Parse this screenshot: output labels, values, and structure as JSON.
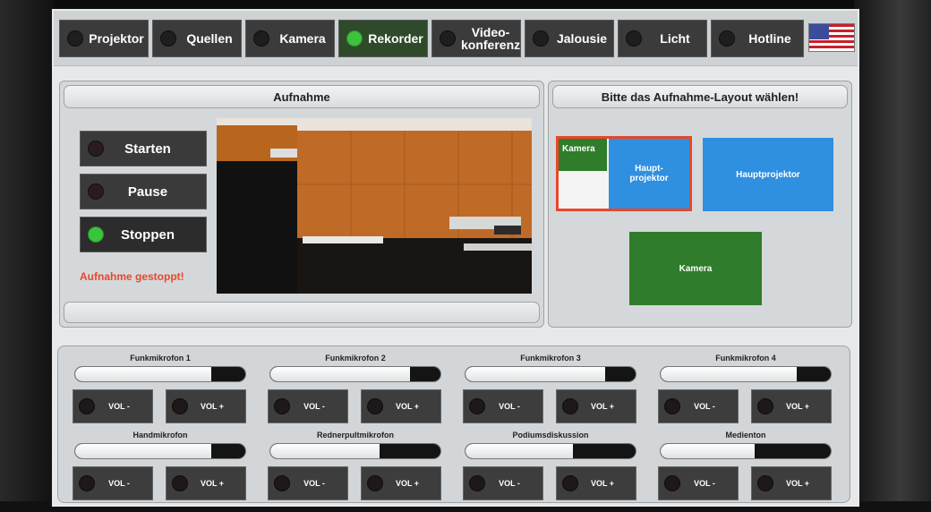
{
  "nav": {
    "tabs": [
      {
        "label": "Projektor",
        "active": false
      },
      {
        "label": "Quellen",
        "active": false
      },
      {
        "label": "Kamera",
        "active": false
      },
      {
        "label": "Rekorder",
        "active": true
      },
      {
        "label": "Video-\nkonferenz",
        "active": false
      },
      {
        "label": "Jalousie",
        "active": false
      },
      {
        "label": "Licht",
        "active": false
      },
      {
        "label": "Hotline",
        "active": false
      }
    ],
    "language_flag_icon": "us-flag-icon"
  },
  "recording": {
    "title": "Aufnahme",
    "buttons": [
      {
        "label": "Starten",
        "active": false
      },
      {
        "label": "Pause",
        "active": false
      },
      {
        "label": "Stoppen",
        "active": true
      }
    ],
    "status": "Aufnahme gestoppt!"
  },
  "layout": {
    "title": "Bitte das Aufnahme-Layout wählen!",
    "options": {
      "combo_camera": "Kamera",
      "combo_projector": "Haupt-\nprojektor",
      "projector_only": "Hauptprojektor",
      "camera_only": "Kamera"
    }
  },
  "audio": {
    "channels": [
      {
        "label": "Funkmikrofon 1",
        "level": 0.8
      },
      {
        "label": "Funkmikrofon 2",
        "level": 0.82
      },
      {
        "label": "Funkmikrofon 3",
        "level": 0.82
      },
      {
        "label": "Funkmikrofon 4",
        "level": 0.8
      },
      {
        "label": "Handmikrofon",
        "level": 0.8
      },
      {
        "label": "Rednerpultmikrofon",
        "level": 0.64
      },
      {
        "label": "Podiumsdiskussion",
        "level": 0.63
      },
      {
        "label": "Medienton",
        "level": 0.55
      }
    ],
    "vol_minus": "VOL -",
    "vol_plus": "VOL +"
  },
  "colors": {
    "accent_green": "#3cc23c",
    "selection_border": "#e8472a",
    "tile_blue": "#2f8fe0",
    "tile_green": "#2f7d2a",
    "status_red": "#e8472a"
  }
}
